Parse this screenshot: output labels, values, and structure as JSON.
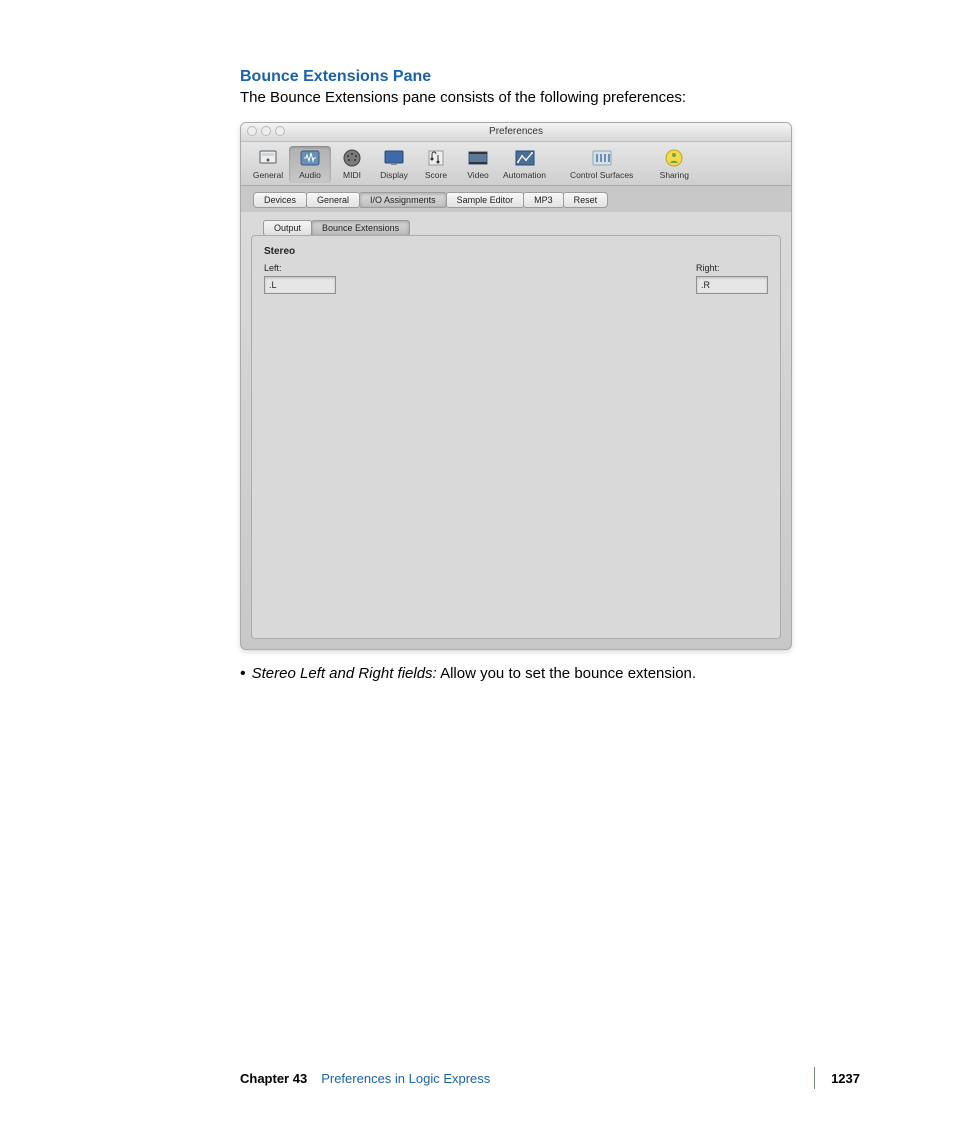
{
  "heading": "Bounce Extensions Pane",
  "intro": "The Bounce Extensions pane consists of the following preferences:",
  "window": {
    "title": "Preferences",
    "toolbar": [
      {
        "name": "general",
        "label": "General",
        "active": false,
        "icon": "general"
      },
      {
        "name": "audio",
        "label": "Audio",
        "active": true,
        "icon": "audio"
      },
      {
        "name": "midi",
        "label": "MIDI",
        "active": false,
        "icon": "midi"
      },
      {
        "name": "display",
        "label": "Display",
        "active": false,
        "icon": "display"
      },
      {
        "name": "score",
        "label": "Score",
        "active": false,
        "icon": "score"
      },
      {
        "name": "video",
        "label": "Video",
        "active": false,
        "icon": "video"
      },
      {
        "name": "automation",
        "label": "Automation",
        "active": false,
        "icon": "automation"
      },
      {
        "name": "control-surfaces",
        "label": "Control Surfaces",
        "active": false,
        "icon": "control"
      },
      {
        "name": "sharing",
        "label": "Sharing",
        "active": false,
        "icon": "sharing"
      }
    ],
    "subtabs": [
      {
        "name": "devices",
        "label": "Devices",
        "active": false
      },
      {
        "name": "general",
        "label": "General",
        "active": false
      },
      {
        "name": "io-assignments",
        "label": "I/O Assignments",
        "active": true
      },
      {
        "name": "sample-editor",
        "label": "Sample Editor",
        "active": false
      },
      {
        "name": "mp3",
        "label": "MP3",
        "active": false
      },
      {
        "name": "reset",
        "label": "Reset",
        "active": false
      }
    ],
    "innertabs": [
      {
        "name": "output",
        "label": "Output",
        "active": false
      },
      {
        "name": "bounce-extensions",
        "label": "Bounce Extensions",
        "active": true
      }
    ],
    "group": {
      "label": "Stereo",
      "left": {
        "label": "Left:",
        "value": ".L"
      },
      "right": {
        "label": "Right:",
        "value": ".R"
      }
    }
  },
  "bullet": {
    "term": "Stereo Left and Right fields:",
    "desc": "  Allow you to set the bounce extension."
  },
  "footer": {
    "chapter": "Chapter 43",
    "title": "Preferences in Logic Express",
    "page": "1237"
  }
}
